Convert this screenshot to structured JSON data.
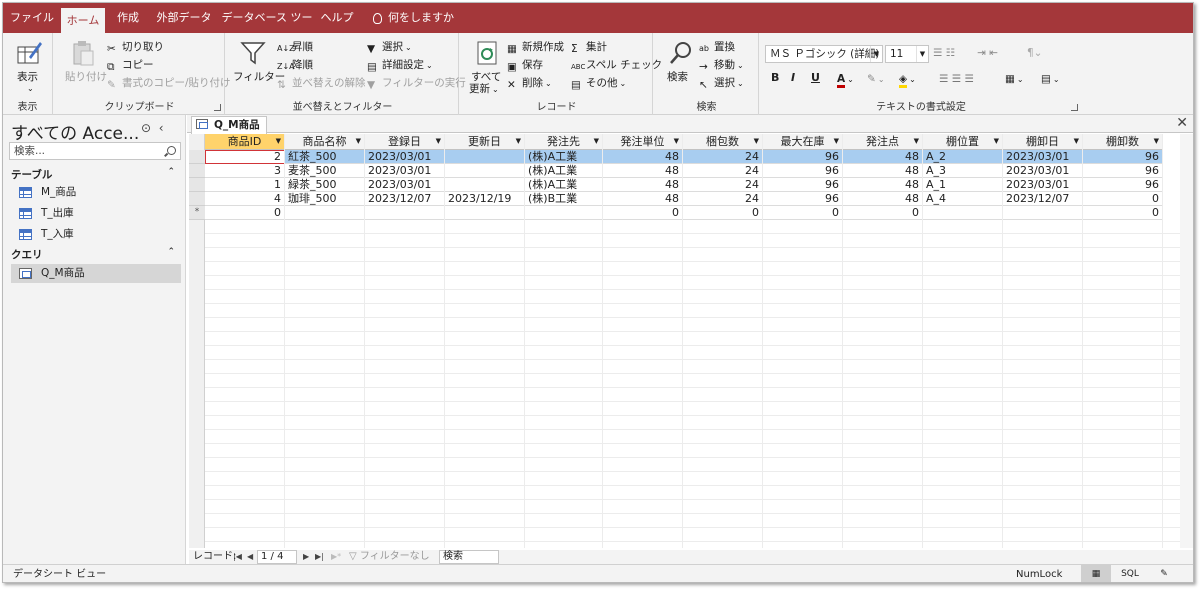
{
  "menu": {
    "tabs": [
      "ファイル",
      "ホーム",
      "作成",
      "外部データ",
      "データベース ツール",
      "ヘルプ"
    ],
    "tell_me": "何をしますか"
  },
  "ribbon": {
    "view": {
      "label": "表示",
      "group": "表示"
    },
    "clipboard": {
      "paste": "貼り付け",
      "cut": "切り取り",
      "copy": "コピー",
      "format_painter": "書式のコピー/貼り付け",
      "group": "クリップボード"
    },
    "sort_filter": {
      "filter": "フィルター",
      "ascending": "昇順",
      "descending": "降順",
      "remove_sort": "並べ替えの解除",
      "selection": "選択",
      "advanced": "詳細設定",
      "toggle_filter": "フィルターの実行",
      "group": "並べ替えとフィルター"
    },
    "records": {
      "refresh_1": "すべて",
      "refresh_2": "更新",
      "new": "新規作成",
      "save": "保存",
      "delete": "削除",
      "totals": "集計",
      "spelling": "スペル チェック",
      "more": "その他",
      "group": "レコード"
    },
    "find": {
      "find": "検索",
      "replace": "置換",
      "goto": "移動",
      "select": "選択",
      "group": "検索"
    },
    "text_format": {
      "font": "ＭＳ Ｐゴシック (詳細)",
      "size": "11",
      "bold": "B",
      "italic": "I",
      "underline": "U",
      "group": "テキストの書式設定"
    }
  },
  "nav": {
    "title": "すべての Acce...",
    "search_placeholder": "検索...",
    "sections": [
      {
        "label": "テーブル",
        "items": [
          "M_商品",
          "T_出庫",
          "T_入庫"
        ]
      },
      {
        "label": "クエリ",
        "items": [
          "Q_M商品"
        ]
      }
    ]
  },
  "document": {
    "tab": "Q_M商品",
    "columns": [
      "商品ID",
      "商品名称",
      "登録日",
      "更新日",
      "発注先",
      "発注単位",
      "梱包数",
      "最大在庫",
      "発注点",
      "棚位置",
      "棚卸日",
      "棚卸数"
    ],
    "rows": [
      [
        "2",
        "紅茶_500",
        "2023/03/01",
        "",
        "(株)A工業",
        "48",
        "24",
        "96",
        "48",
        "A_2",
        "2023/03/01",
        "96"
      ],
      [
        "3",
        "麦茶_500",
        "2023/03/01",
        "",
        "(株)A工業",
        "48",
        "24",
        "96",
        "48",
        "A_3",
        "2023/03/01",
        "96"
      ],
      [
        "1",
        "緑茶_500",
        "2023/03/01",
        "",
        "(株)A工業",
        "48",
        "24",
        "96",
        "48",
        "A_1",
        "2023/03/01",
        "96"
      ],
      [
        "4",
        "珈琲_500",
        "2023/12/07",
        "2023/12/19",
        "(株)B工業",
        "48",
        "24",
        "96",
        "48",
        "A_4",
        "2023/12/07",
        "0"
      ]
    ],
    "new_row": [
      "0",
      "",
      "",
      "",
      "",
      "0",
      "0",
      "0",
      "0",
      "",
      "",
      "0"
    ],
    "new_row_marker": "*"
  },
  "recnav": {
    "label": "レコード:",
    "position": "1 / 4",
    "filter": "フィルターなし",
    "search": "検索"
  },
  "status": {
    "view_name": "データシート ビュー",
    "numlock": "NumLock",
    "sql": "SQL"
  }
}
